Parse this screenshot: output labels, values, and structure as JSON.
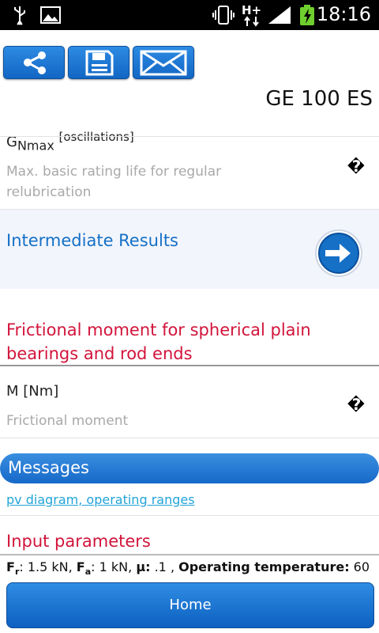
{
  "status_bar": {
    "time": "18:16",
    "icons": [
      "usb-icon",
      "image-icon",
      "vibrate-icon",
      "hplus-data-icon",
      "signal-icon",
      "battery-charging-icon"
    ],
    "network_label": "H+"
  },
  "toolbar": {
    "buttons": [
      "share-icon",
      "save-icon",
      "mail-icon"
    ],
    "product": "GE 100 ES"
  },
  "life": {
    "symbol": "G",
    "symbol_sub": "Nmax",
    "unit": "[oscillations]",
    "desc": "Max. basic rating life for regular relubrication",
    "value": "�"
  },
  "intermediate": {
    "label": "Intermediate Results"
  },
  "friction": {
    "heading": "Frictional moment for spherical plain bearings and rod ends",
    "qty": "M [Nm]",
    "desc": "Frictional moment",
    "value": "�"
  },
  "messages": {
    "title": "Messages",
    "link": "pv diagram, operating ranges"
  },
  "input": {
    "heading": "Input parameters"
  },
  "bottom": {
    "fr_sym": "F",
    "fr_sub": "r",
    "fr_val": ": 1.5 kN, ",
    "fa_sym": "F",
    "fa_sub": "a",
    "fa_val": ": 1 kN, ",
    "mu_sym": "μ:",
    "mu_val": " .1 , ",
    "temp_label": "Operating temperature:",
    "temp_val": " 60"
  },
  "home": {
    "label": "Home"
  },
  "colors": {
    "accent": "#1570c6",
    "red": "#d2143a",
    "link": "#22a4d8"
  }
}
